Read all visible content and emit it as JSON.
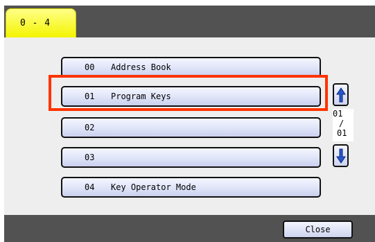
{
  "tab": {
    "label": "0 - 4"
  },
  "menu": {
    "items": [
      {
        "num": "00",
        "label": "Address Book"
      },
      {
        "num": "01",
        "label": "Program Keys"
      },
      {
        "num": "02",
        "label": ""
      },
      {
        "num": "03",
        "label": ""
      },
      {
        "num": "04",
        "label": "Key Operator Mode"
      }
    ],
    "highlighted_index": 1
  },
  "pager": {
    "current": "01",
    "slash": "/",
    "total": "01",
    "up_icon": "arrow-up-icon",
    "down_icon": "arrow-down-icon"
  },
  "footer": {
    "close_label": "Close"
  },
  "colors": {
    "tab": "#f4f400",
    "bar": "#525252",
    "content_bg": "#eeeeee",
    "highlight": "#ff3300",
    "arrow": "#2a55c8"
  }
}
